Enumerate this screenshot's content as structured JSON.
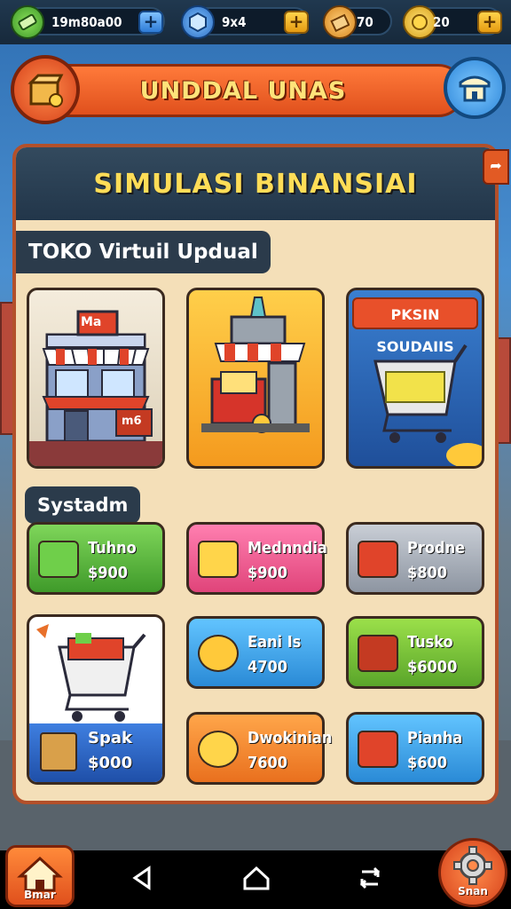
{
  "top_bar": {
    "cash": "19m80a00",
    "gems": "9x4",
    "stock": "70",
    "coins": "20",
    "plus_symbol": "+"
  },
  "header": {
    "title": "UNDDAL UNAS"
  },
  "panel": {
    "title": "SIMULASI BINANSIAI"
  },
  "stores": {
    "section_label": "TOKO Virtuil Updual",
    "store1_sign": "Ma",
    "store1_door_sign": "m6",
    "store3_label": "PKSIN SOUDAIIS"
  },
  "products": {
    "section_label": "Systadm",
    "items": [
      {
        "name": "Tuhno",
        "price": "$900"
      },
      {
        "name": "Mednndia",
        "price": "$900"
      },
      {
        "name": "Prodne",
        "price": "$800"
      },
      {
        "name": "Eani Is",
        "price": "4700"
      },
      {
        "name": "Tusko",
        "price": "$6000"
      },
      {
        "name": "Spak",
        "price": "$000"
      },
      {
        "name": "Dwokinian",
        "price": "7600"
      },
      {
        "name": "Pianha",
        "price": "$600"
      }
    ]
  },
  "bottom_nav": {
    "home_label": "Bmar",
    "settings_label": "Snan"
  },
  "colors": {
    "accent": "#e0501d",
    "title_yellow": "#ffdd57",
    "panel_bg": "#f4dfb8"
  }
}
